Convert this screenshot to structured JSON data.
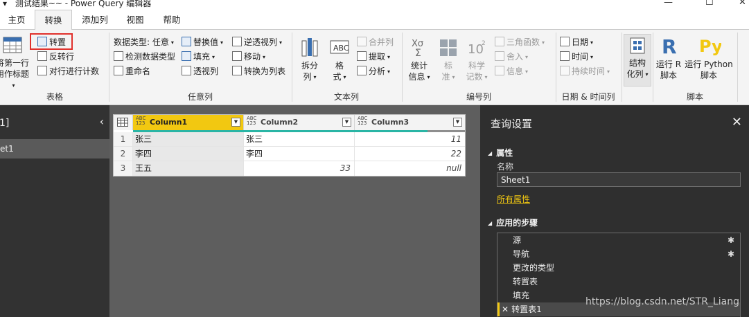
{
  "window": {
    "title": "测试结果~~ - Power Query 编辑器",
    "quick_access": "▾",
    "minimize": "—",
    "maximize": "☐",
    "close": "✕"
  },
  "tabs": [
    {
      "label": "主页",
      "active": false
    },
    {
      "label": "转换",
      "active": true
    },
    {
      "label": "添加列",
      "active": false
    },
    {
      "label": "视图",
      "active": false
    },
    {
      "label": "帮助",
      "active": false
    }
  ],
  "ribbon": {
    "table_group": {
      "label": "表格",
      "first_row_line1": "将第一行",
      "first_row_line2": "用作标题",
      "transpose": "转置",
      "reverse_rows": "反转行",
      "count_rows": "对行进行计数"
    },
    "any_column_group": {
      "label": "任意列",
      "data_type": "数据类型: 任意",
      "detect_type": "检测数据类型",
      "rename": "重命名",
      "replace_values": "替换值",
      "fill": "填充",
      "pivot": "透视列",
      "unpivot": "逆透视列",
      "move": "移动",
      "to_list": "转换为列表"
    },
    "text_column_group": {
      "label": "文本列",
      "split_line1": "拆分",
      "split_line2": "列",
      "format_line1": "格",
      "format_line2": "式",
      "merge": "合并列",
      "extract": "提取",
      "parse": "分析"
    },
    "number_column_group": {
      "label": "编号列",
      "stats_line1": "统计",
      "stats_line2": "信息",
      "standard_line1": "标",
      "standard_line2": "准",
      "science_line1": "科学",
      "science_line2": "记数",
      "trig": "三角函数",
      "rounding": "舍入",
      "info": "信息"
    },
    "datetime_group": {
      "label": "日期 & 时间列",
      "date": "日期",
      "time": "时间",
      "duration": "持续时间"
    },
    "structured_group": {
      "line1": "结构",
      "line2": "化列"
    },
    "script_group": {
      "label": "脚本",
      "r_line1": "运行 R",
      "r_line2": "脚本",
      "py_line1": "运行 Python",
      "py_line2": "脚本"
    }
  },
  "left_pane": {
    "header": "1]",
    "chevron": "‹",
    "selected_item": "et1"
  },
  "grid": {
    "type_badge_top": "ABC",
    "type_badge_bottom": "123",
    "columns": [
      "Column1",
      "Column2",
      "Column3"
    ],
    "rows": [
      {
        "n": "1",
        "c1": "张三",
        "c2": "张三",
        "c3": "11"
      },
      {
        "n": "2",
        "c1": "李四",
        "c2": "李四",
        "c3": "22"
      },
      {
        "n": "3",
        "c1": "王五",
        "c2": "33",
        "c3": "null"
      }
    ]
  },
  "query_settings": {
    "title": "查询设置",
    "close": "✕",
    "properties_header": "属性",
    "name_label": "名称",
    "name_value": "Sheet1",
    "all_properties": "所有属性",
    "steps_header": "应用的步骤",
    "steps": [
      {
        "label": "源",
        "has_gear": true
      },
      {
        "label": "导航",
        "has_gear": true
      },
      {
        "label": "更改的类型",
        "has_gear": false
      },
      {
        "label": "转置表",
        "has_gear": false
      },
      {
        "label": "填充",
        "has_gear": false
      },
      {
        "label": "转置表1",
        "has_gear": false
      }
    ]
  },
  "watermark": "https://blog.csdn.net/STR_Liang",
  "colors": {
    "accent_yellow": "#f2c811",
    "highlight_red": "#e0302b",
    "quality_teal": "#2ab5a5",
    "pane_dark": "#2f2f2f"
  }
}
